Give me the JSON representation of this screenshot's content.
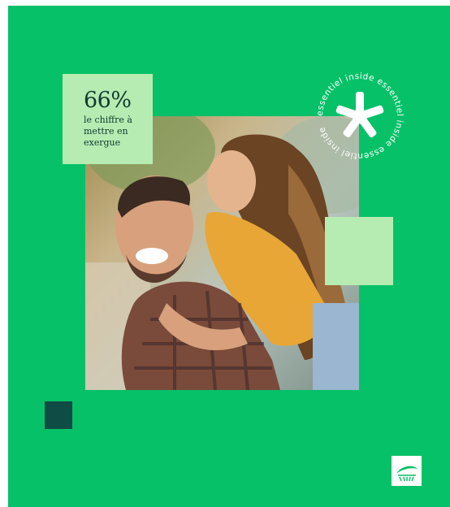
{
  "stat": {
    "value": "66%",
    "caption": "le chiffre à mettre en exergue"
  },
  "badge": {
    "ring_text": "essentiel inside essentiel inside essentiel inside "
  },
  "colors": {
    "background": "#06c167",
    "light_green": "#b6ecb1",
    "dark_teal": "#0f4c45",
    "text_dark": "#123a32"
  },
  "icons": {
    "badge": "asterisk-icon",
    "brand": "brand-logo-icon"
  }
}
